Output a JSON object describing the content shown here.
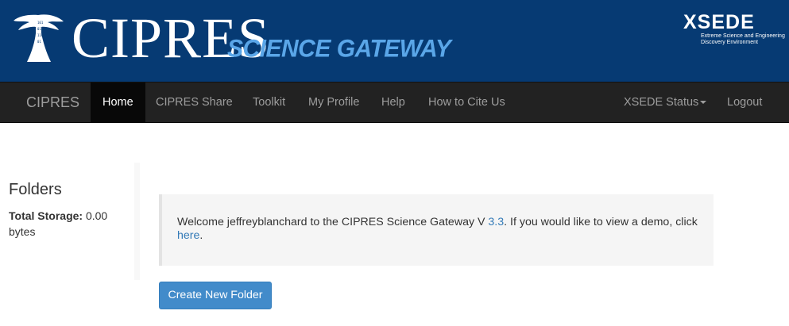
{
  "banner": {
    "brand_main": "CIPRES",
    "brand_sub": "SCIENCE GATEWAY",
    "xsede_word": "XSEDE",
    "xsede_tag_line1": "Extreme Science and Engineering",
    "xsede_tag_line2": "Discovery Environment"
  },
  "navbar": {
    "brand": "CIPRES",
    "items": [
      {
        "label": "Home"
      },
      {
        "label": "CIPRES Share"
      },
      {
        "label": "Toolkit"
      },
      {
        "label": "My Profile"
      },
      {
        "label": "Help"
      },
      {
        "label": "How to Cite Us"
      }
    ],
    "right_items": [
      {
        "label": "XSEDE Status"
      },
      {
        "label": "Logout"
      }
    ]
  },
  "sidebar": {
    "title": "Folders",
    "storage_label": "Total Storage:",
    "storage_value": "0.00 bytes"
  },
  "welcome": {
    "text_part1": "Welcome jeffreyblanchard to the CIPRES Science Gateway V ",
    "version_link": "3.3",
    "text_part2": ". If you would like to view a demo, click ",
    "demo_link": "here",
    "text_part3": "."
  },
  "actions": {
    "create_folder": "Create New Folder"
  },
  "colors": {
    "banner_bg": "#063a73",
    "subtitle": "#5aa6e8",
    "navbar_bg": "#222222",
    "link": "#337ab7",
    "button": "#428bca"
  }
}
